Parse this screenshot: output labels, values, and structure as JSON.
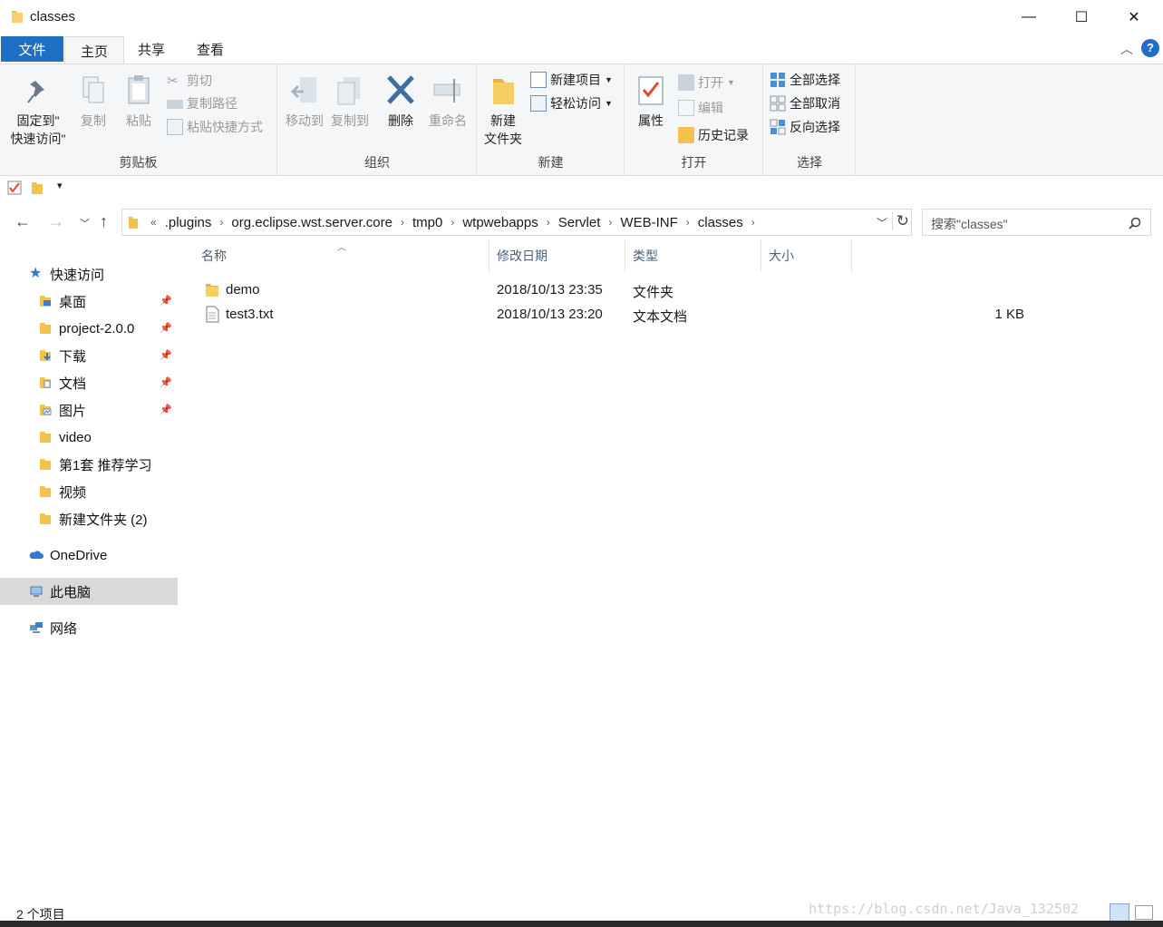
{
  "window": {
    "title": "classes",
    "controls": [
      "—",
      "☐",
      "✕"
    ]
  },
  "tabs": [
    "文件",
    "主页",
    "共享",
    "查看"
  ],
  "ribbon": {
    "clipboard": {
      "label": "剪贴板",
      "pin": "固定到\"\n快速访问\"",
      "pin1": "固定到\"",
      "pin2": "快速访问\"",
      "copy": "复制",
      "paste": "粘贴",
      "cut": "剪切",
      "copy_path": "复制路径",
      "paste_shortcut": "粘贴快捷方式"
    },
    "organize": {
      "label": "组织",
      "move_to": "移动到",
      "copy_to": "复制到",
      "delete": "删除",
      "rename": "重命名"
    },
    "new": {
      "label": "新建",
      "new_folder1": "新建",
      "new_folder2": "文件夹",
      "new_item": "新建项目",
      "easy_access": "轻松访问"
    },
    "open": {
      "label": "打开",
      "properties": "属性",
      "open": "打开",
      "edit": "编辑",
      "history": "历史记录"
    },
    "select": {
      "label": "选择",
      "select_all": "全部选择",
      "select_none": "全部取消",
      "invert": "反向选择"
    }
  },
  "address": {
    "prefix": "«",
    "crumbs": [
      ".plugins",
      "org.eclipse.wst.server.core",
      "tmp0",
      "wtpwebapps",
      "Servlet",
      "WEB-INF",
      "classes"
    ]
  },
  "search": {
    "placeholder": "搜索\"classes\""
  },
  "navpane": {
    "quick_access": "快速访问",
    "pinned": [
      "桌面",
      "project-2.0.0",
      "下载",
      "文档",
      "图片"
    ],
    "folders": [
      "video",
      "第1套 推荐学习",
      "视频",
      "新建文件夹 (2)"
    ],
    "onedrive": "OneDrive",
    "this_pc": "此电脑",
    "network": "网络"
  },
  "columns": {
    "name": "名称",
    "modified": "修改日期",
    "type": "类型",
    "size": "大小"
  },
  "files": [
    {
      "name": "demo",
      "modified": "2018/10/13 23:35",
      "type": "文件夹",
      "size": ""
    },
    {
      "name": "test3.txt",
      "modified": "2018/10/13 23:20",
      "type": "文本文档",
      "size": "1 KB"
    }
  ],
  "status": {
    "count": "2 个项目"
  },
  "watermark": "https://blog.csdn.net/Java_132502",
  "colors": {
    "accent": "#1e6fc5",
    "folder": "#f3c24d",
    "selected": "#d9d9d9"
  }
}
